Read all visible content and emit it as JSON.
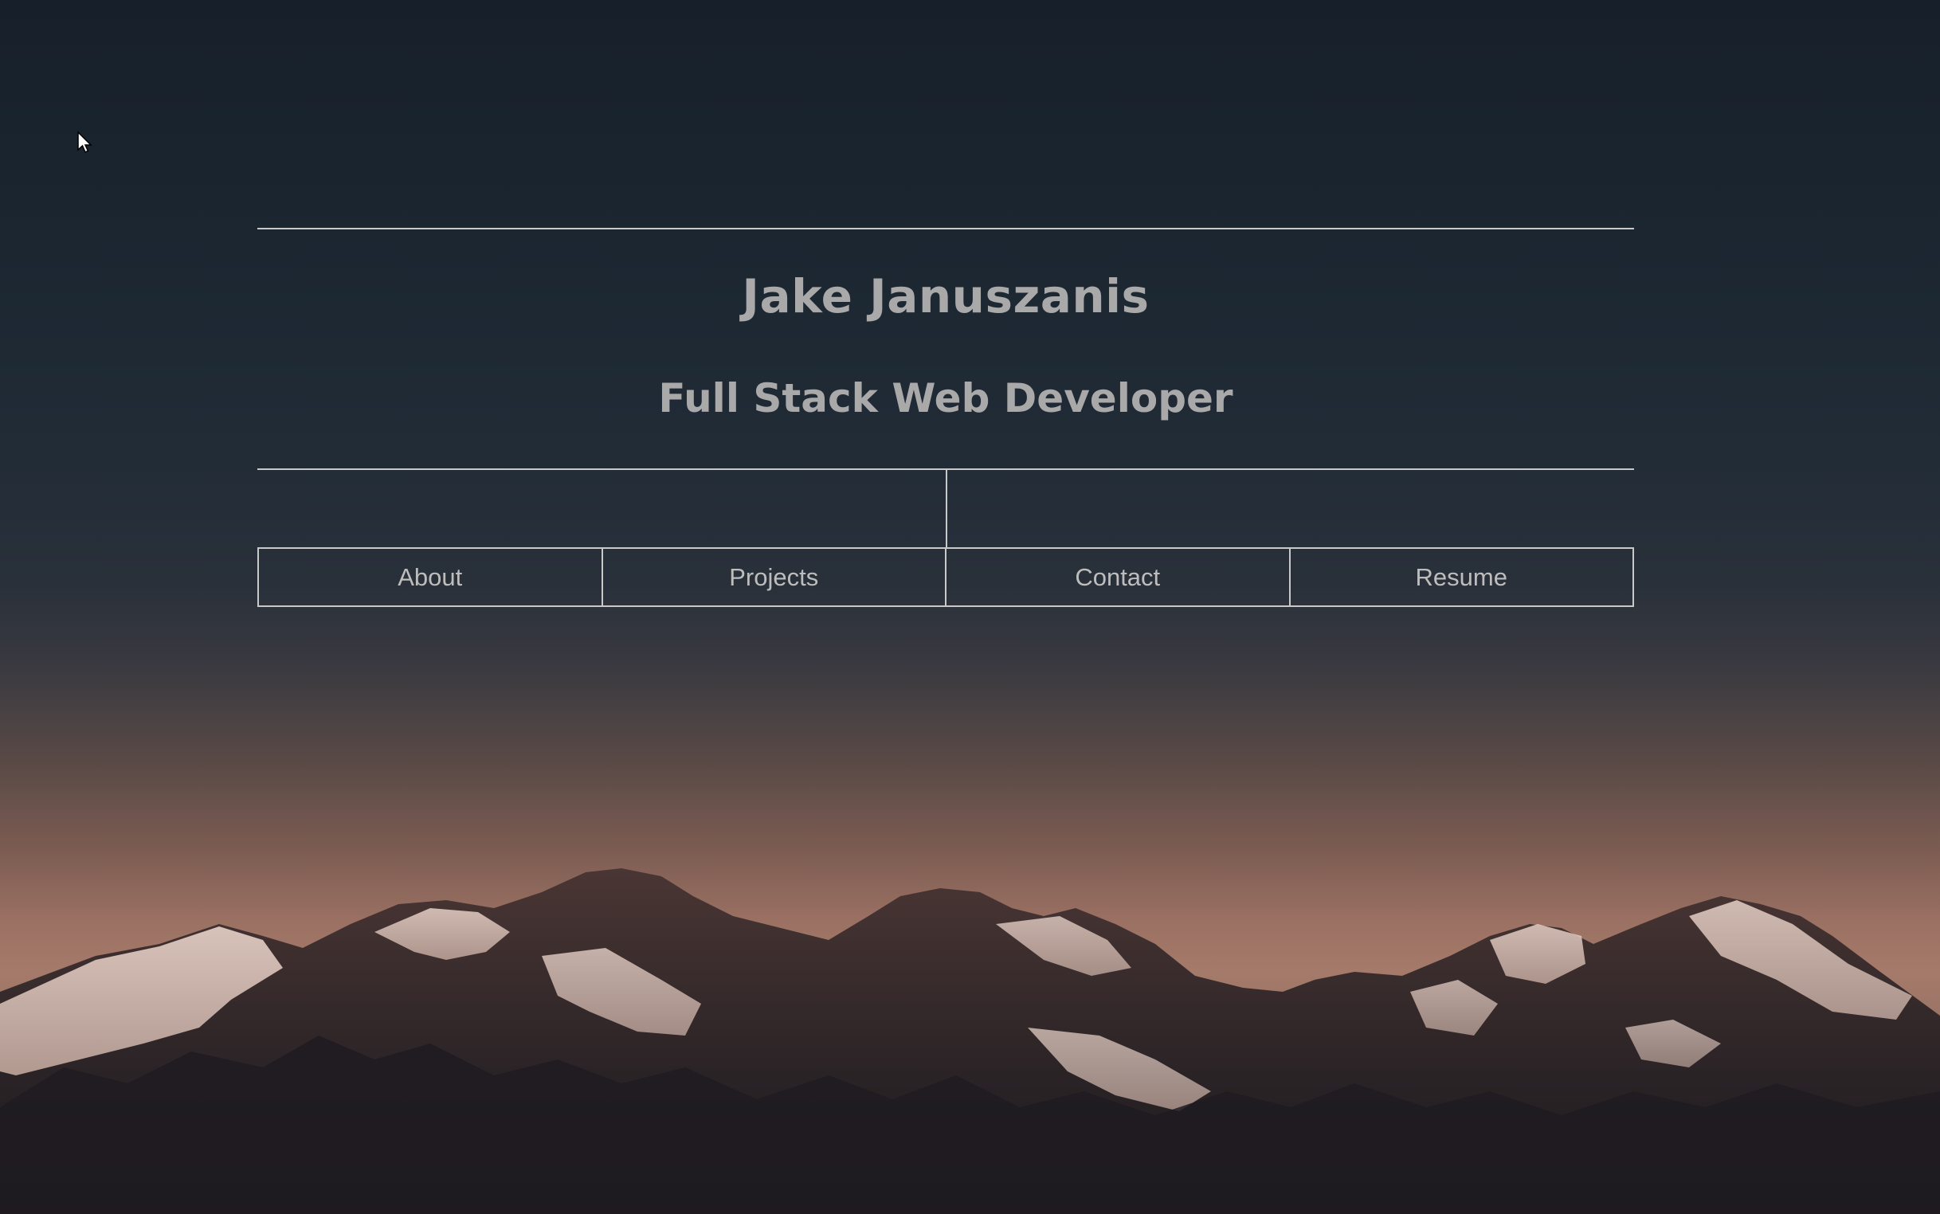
{
  "header": {
    "name": "Jake Januszanis",
    "role": "Full Stack Web Developer"
  },
  "nav": {
    "items": [
      {
        "label": "About"
      },
      {
        "label": "Projects"
      },
      {
        "label": "Contact"
      },
      {
        "label": "Resume"
      }
    ]
  },
  "colors": {
    "text": "#a9a9a9",
    "nav_text": "#bdbdbd",
    "border": "#c9c9c9",
    "sky_top": "#17202a",
    "sky_glow": "#a57a6a"
  },
  "background": {
    "icon": "mountain-range-image"
  },
  "cursor": {
    "icon": "mouse-pointer-icon"
  }
}
